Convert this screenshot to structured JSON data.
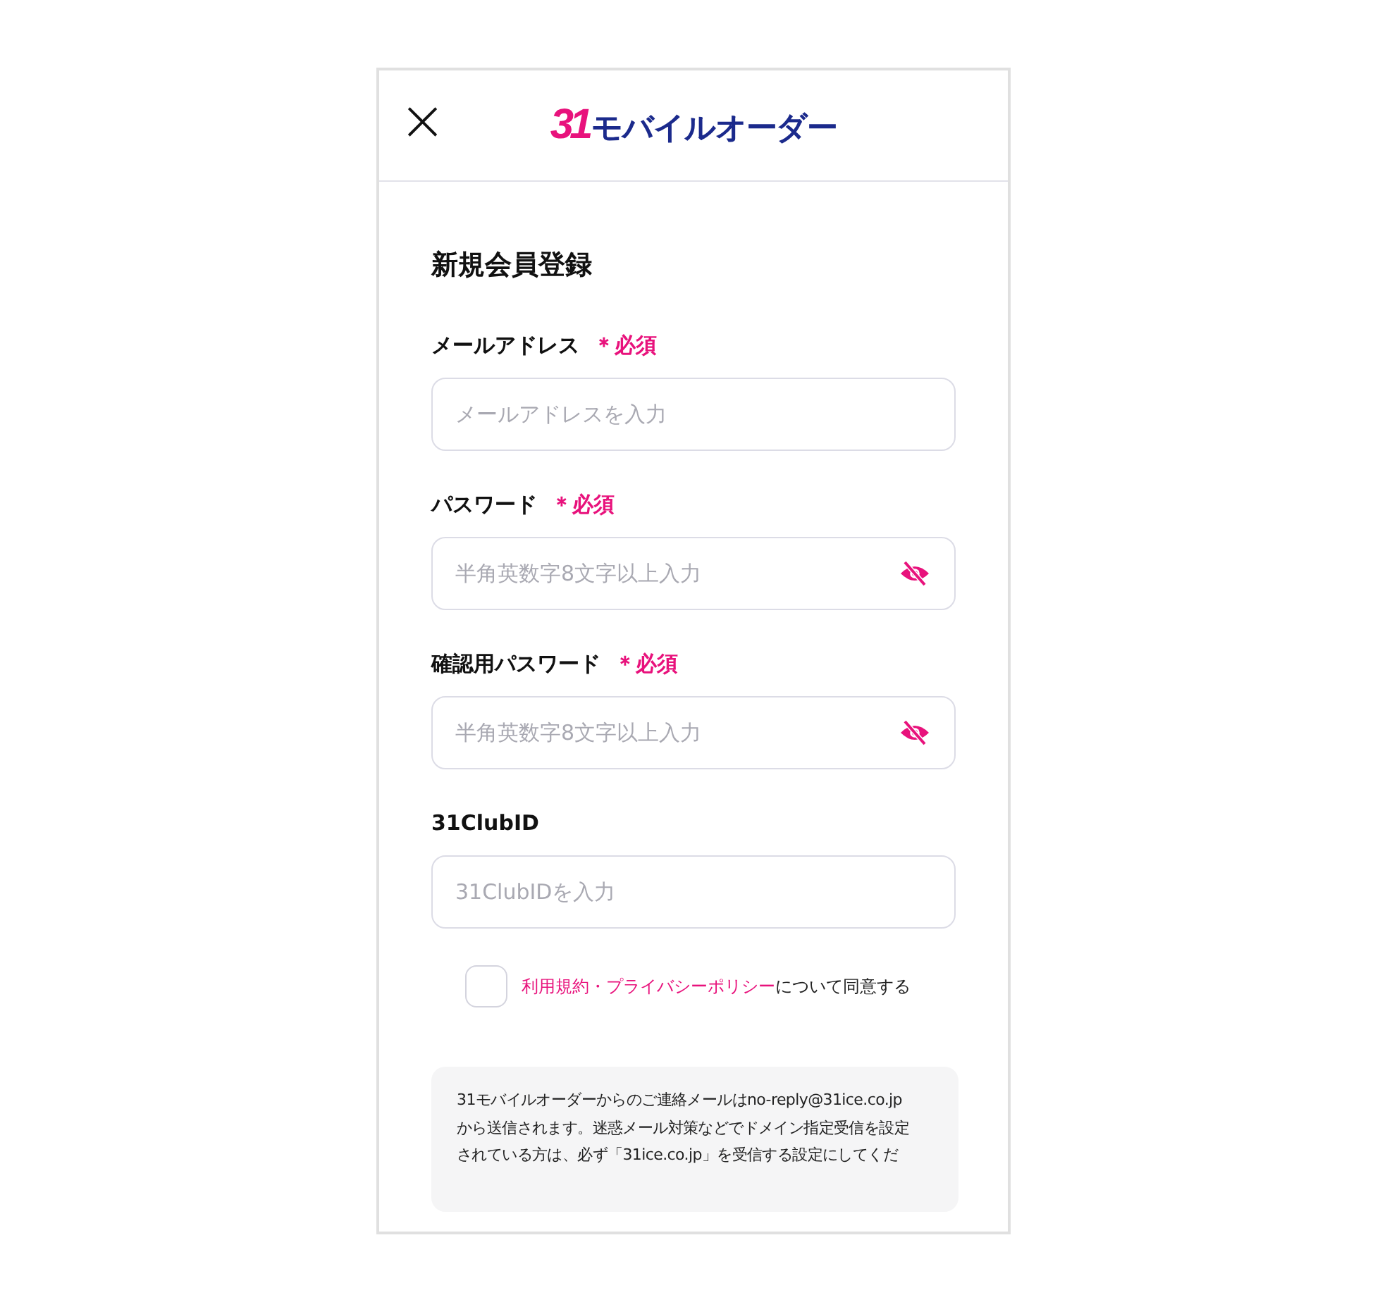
{
  "header": {
    "close": "×",
    "logo_number": "31",
    "logo_text": "モバイルオーダー"
  },
  "title": "新規会員登録",
  "fields": [
    {
      "label": "メールアドレス",
      "required_mark": "＊必須",
      "placeholder": "メールアドレスを入力",
      "kind": "text"
    },
    {
      "label": "パスワード",
      "required_mark": "＊必須",
      "placeholder": "半角英数字8文字以上入力",
      "kind": "password",
      "visible": false
    },
    {
      "label": "確認用パスワード",
      "required_mark": "＊必須",
      "placeholder": "半角英数字8文字以上入力",
      "kind": "password",
      "visible": false
    },
    {
      "label": "31ClubID",
      "placeholder": "31ClubIDを入力",
      "kind": "text"
    }
  ],
  "agreement": {
    "checked": false,
    "link": "利用規約・プライバシーポリシー",
    "text": "について同意する"
  },
  "notice": [
    "31モバイルオーダーからのご連絡メールはno-reply@31ice.co.jp",
    "から送信されます。迷惑メール対策などでドメイン指定受信を設定",
    "されている方は、必ず「31ice.co.jp」を受信する設定にしてくだ"
  ]
}
